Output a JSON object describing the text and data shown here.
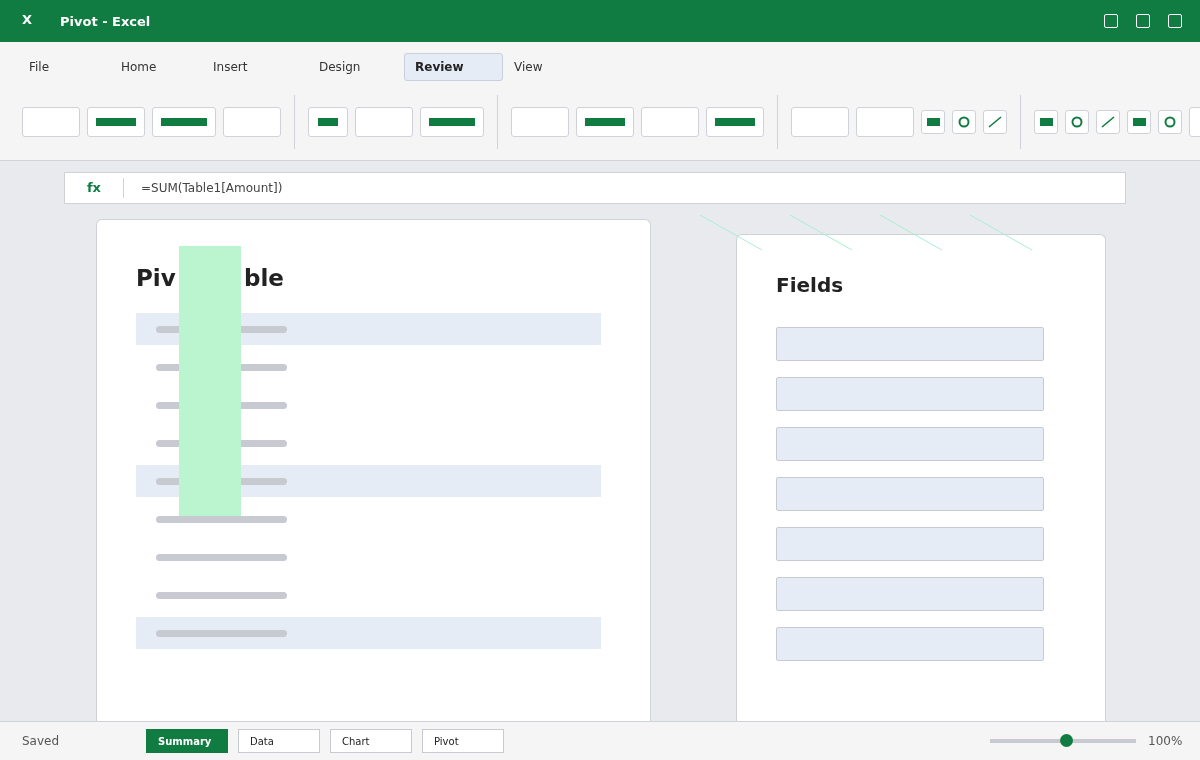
{
  "window": {
    "app_letter": "X",
    "title": "Pivot - Excel"
  },
  "ribbon_tabs": [
    {
      "label": "File",
      "selected": false
    },
    {
      "label": "Home",
      "selected": false
    },
    {
      "label": "Insert",
      "selected": false
    },
    {
      "label": "Design",
      "selected": false
    },
    {
      "label": "Review",
      "selected": true
    },
    {
      "label": "View",
      "selected": false
    }
  ],
  "ribbon_groups": [
    {
      "tools": [
        {
          "kind": "blank"
        },
        {
          "kind": "bar"
        },
        {
          "kind": "widebar"
        },
        {
          "kind": "blank"
        }
      ]
    },
    {
      "tools": [
        {
          "kind": "smallbar"
        },
        {
          "kind": "blank"
        },
        {
          "kind": "widebar"
        }
      ]
    },
    {
      "tools": [
        {
          "kind": "blank"
        },
        {
          "kind": "bar"
        },
        {
          "kind": "blank"
        },
        {
          "kind": "bar"
        }
      ]
    },
    {
      "tools": [
        {
          "kind": "blank"
        },
        {
          "kind": "blank"
        },
        {
          "kind": "square"
        },
        {
          "kind": "circle"
        },
        {
          "kind": "line"
        }
      ]
    },
    {
      "tools": [
        {
          "kind": "square"
        },
        {
          "kind": "circle"
        },
        {
          "kind": "line"
        },
        {
          "kind": "square"
        },
        {
          "kind": "circle"
        },
        {
          "kind": "blank"
        }
      ]
    }
  ],
  "formula_bar": {
    "label": "fx",
    "value": "=SUM(Table1[Amount])"
  },
  "pivot_card": {
    "title_start": "Piv",
    "title_end": "ble",
    "rows": [
      {
        "highlighted": true
      },
      {
        "highlighted": false
      },
      {
        "highlighted": false
      },
      {
        "highlighted": false
      },
      {
        "highlighted": true
      },
      {
        "highlighted": false
      },
      {
        "highlighted": false
      },
      {
        "highlighted": false
      },
      {
        "highlighted": true
      }
    ]
  },
  "fields_card": {
    "title": "Fields",
    "slots": [
      {
        "kind": "empty"
      },
      {
        "kind": "empty"
      },
      {
        "kind": "empty"
      },
      {
        "kind": "empty"
      },
      {
        "kind": "empty"
      },
      {
        "kind": "empty"
      },
      {
        "kind": "empty"
      }
    ]
  },
  "status_bar": {
    "status": "Saved",
    "sheets": [
      {
        "label": "Summary",
        "selected": true
      },
      {
        "label": "Data",
        "selected": false
      },
      {
        "label": "Chart",
        "selected": false
      },
      {
        "label": "Pivot",
        "selected": false
      }
    ],
    "zoom": {
      "level": 0.52,
      "reading": "100%"
    }
  }
}
